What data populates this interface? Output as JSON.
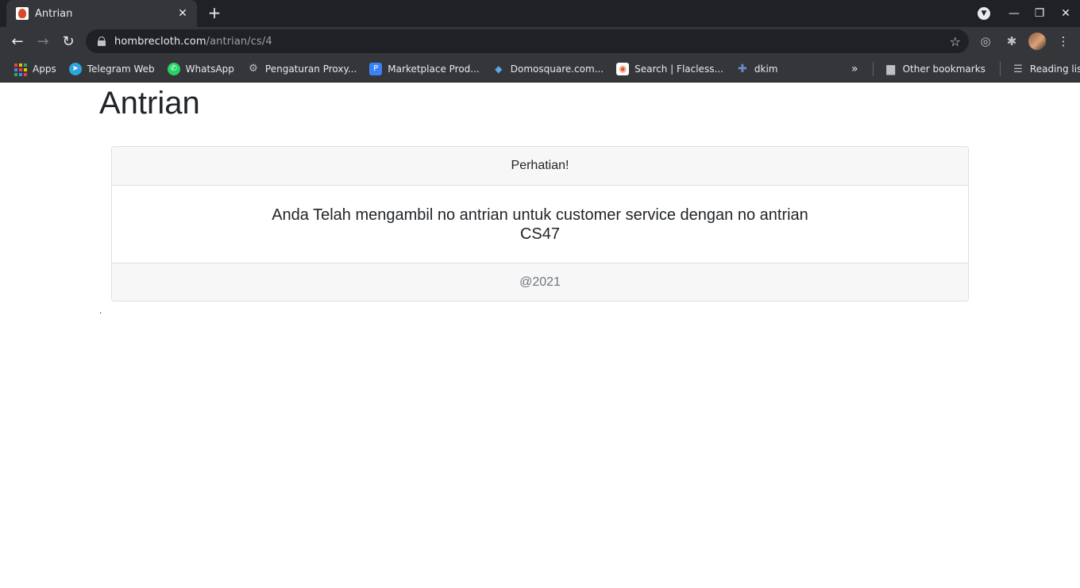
{
  "browser": {
    "tab": {
      "title": "Antrian"
    },
    "address": {
      "host": "hombrecloth.com",
      "path": "/antrian/cs/4"
    },
    "bookmarks": [
      {
        "label": "Apps",
        "icon": "apps-grid-icon"
      },
      {
        "label": "Telegram Web",
        "icon": "telegram-icon",
        "color": "#2ca5e0"
      },
      {
        "label": "WhatsApp",
        "icon": "whatsapp-icon",
        "color": "#25d366"
      },
      {
        "label": "Pengaturan Proxy...",
        "icon": "proxy-icon",
        "color": "#8d8d8d"
      },
      {
        "label": "Marketplace Prod...",
        "icon": "marketplace-icon",
        "color": "#3b82f6"
      },
      {
        "label": "Domosquare.com...",
        "icon": "cube-icon",
        "color": "#5aa9e6"
      },
      {
        "label": "Search | Flacless...",
        "icon": "search-site-icon",
        "color": "#e4572e"
      },
      {
        "label": "dkim",
        "icon": "puzzle-icon",
        "color": "#6b8fc7"
      }
    ],
    "other_bookmarks": "Other bookmarks",
    "reading_list": "Reading list"
  },
  "page": {
    "title": "Antrian",
    "card": {
      "header": "Perhatian!",
      "message_line1": "Anda Telah mengambil no antrian untuk customer service dengan no antrian",
      "queue_number": "CS47",
      "footer": "@2021"
    },
    "trailing_text": "."
  }
}
